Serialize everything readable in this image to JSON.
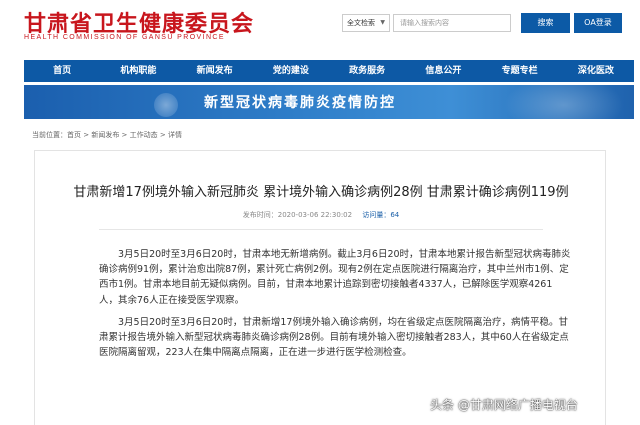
{
  "header": {
    "logo_cn": "甘肃省卫生健康委员会",
    "logo_en": "HEALTH COMMISSION OF GANSU PROVINCE",
    "search_scope": "全文检索",
    "search_placeholder": "请输入搜索内容",
    "search_button": "搜索",
    "oa_button": "OA登录"
  },
  "nav": {
    "items": [
      "首页",
      "机构职能",
      "新闻发布",
      "党的建设",
      "政务服务",
      "信息公开",
      "专题专栏",
      "深化医改"
    ]
  },
  "banner": {
    "title": "新型冠状病毒肺炎疫情防控"
  },
  "breadcrumb": {
    "text": "当前位置：首页 > 新闻发布 > 工作动态 > 详情"
  },
  "article": {
    "title": "甘肃新增17例境外输入新冠肺炎 累计境外输入确诊病例28例 甘肃累计确诊病例119例",
    "published": "发布时间：2020-03-06 22:30:02",
    "views_label": "访问量：",
    "views": "64",
    "paragraphs": [
      "3月5日20时至3月6日20时，甘肃本地无新增病例。截止3月6日20时，甘肃本地累计报告新型冠状病毒肺炎确诊病例91例，累计治愈出院87例，累计死亡病例2例。现有2例在定点医院进行隔离治疗，其中兰州市1例、定西市1例。甘肃本地目前无疑似病例。目前，甘肃本地累计追踪到密切接触者4337人，已解除医学观察4261人，其余76人正在接受医学观察。",
      "3月5日20时至3月6日20时，甘肃新增17例境外输入确诊病例，均在省级定点医院隔离治疗，病情平稳。甘肃累计报告境外输入新型冠状病毒肺炎确诊病例28例。目前有境外输入密切接触者283人，其中60人在省级定点医院隔离留观，223人在集中隔离点隔离，正在进一步进行医学检测检查。"
    ]
  },
  "watermark": {
    "text": "头条 @甘肃网络广播电视台"
  }
}
